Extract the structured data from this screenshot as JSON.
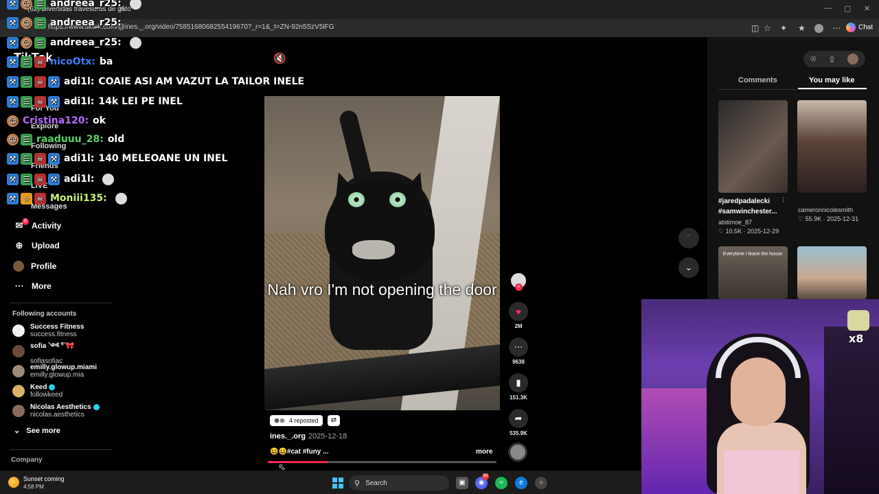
{
  "browser": {
    "tab_title": "(62) Divertidas travesuras de gatos",
    "tab_close": "✕",
    "url": "https://www.tiktok.com/@ines._.org/video/7585168068255419670?_r=1&_t=ZN-92n5SzV5lFG",
    "chat_label": "Chat",
    "win_minimize": "—",
    "win_maximize": "▢",
    "win_close": "✕"
  },
  "tiktok": {
    "logo": "TikTok",
    "mute_icon": "🔇",
    "nav_hidden": [
      "For You",
      "Explore",
      "Following",
      "Friends",
      "LIVE",
      "Messages"
    ],
    "nav": [
      {
        "label": "Activity",
        "icon": "✉",
        "badge": "6"
      },
      {
        "label": "Upload",
        "icon": "⊕"
      },
      {
        "label": "Profile",
        "icon": ""
      },
      {
        "label": "More",
        "icon": "⋯"
      }
    ],
    "following_title": "Following accounts",
    "following": [
      {
        "name": "Success Fitness",
        "handle": "success.fitness",
        "verified": false,
        "color": "#f2f2f2"
      },
      {
        "name": "sofia ༺ ͡° 🎀",
        "handle": "sofiasofiac",
        "verified": false,
        "color": "#6b4b3b"
      },
      {
        "name": "emilly.glowup.miami",
        "handle": "emilly.glowup.mia",
        "verified": false,
        "color": "#9a8a7a"
      },
      {
        "name": "Keed",
        "handle": "followkeed",
        "verified": true,
        "color": "#d9b36b"
      },
      {
        "name": "Nicolas Aesthetics",
        "handle": "nicolas.aesthetics",
        "verified": true,
        "color": "#8a6a5a"
      }
    ],
    "see_more": "See more",
    "company": "Company",
    "video": {
      "caption": "Nah vro I'm not opening the door",
      "reposted": "4 reposted",
      "author": "ines._.org",
      "date": "2025-12-18",
      "description": "😆😆#cat #funy ...",
      "more": "more",
      "progress": 0.26
    },
    "actions": {
      "likes": "2M",
      "comments": "9638",
      "saves": "151.3K",
      "shares": "535.9K"
    },
    "right_panel": {
      "tab_comments": "Comments",
      "tab_you_may_like": "You may like",
      "items": [
        {
          "caption1": "#jaredpadalecki",
          "caption2": "#samwinchester...",
          "user": "abitimoe_87",
          "stats": "♡ 10.5K · 2025-12-29"
        },
        {
          "user": "cameronnicolesmith",
          "stats": "♡ 55.9K · 2025-12-31"
        },
        {
          "overlay": "Everytime I leave the house"
        },
        {}
      ]
    }
  },
  "chat": [
    {
      "user": "andreea_r25:",
      "msg": "",
      "user_color": "#ffffff",
      "badges": [
        "blue",
        "skin",
        "green"
      ],
      "emote": true
    },
    {
      "user": "andreea_r25:",
      "msg": "",
      "user_color": "#ffffff",
      "badges": [
        "blue",
        "skin",
        "green"
      ],
      "emote": false
    },
    {
      "user": "andreea_r25:",
      "msg": "",
      "user_color": "#ffffff",
      "badges": [
        "blue",
        "skin",
        "green"
      ],
      "emote": true
    },
    {
      "user": "nicoOtx:",
      "msg": "ba",
      "user_color": "#3d7bf5",
      "badges": [
        "blue",
        "green",
        "red"
      ],
      "emote": false
    },
    {
      "user": "adi1l:",
      "msg": "COAIE ASI AM VAZUT LA TAILOR INELE",
      "user_color": "#ffffff",
      "badges": [
        "blue",
        "green",
        "red",
        "blue"
      ],
      "emote": false
    },
    {
      "user": "adi1l:",
      "msg": "14k LEI PE INEL",
      "user_color": "#ffffff",
      "badges": [
        "blue",
        "green",
        "red",
        "blue"
      ],
      "emote": false
    },
    {
      "user": "Cristina120:",
      "msg": "ok",
      "user_color": "#b66bff",
      "badges": [
        "skin"
      ],
      "emote": false
    },
    {
      "user": "raaduuu_28:",
      "msg": "old",
      "user_color": "#5bd16a",
      "badges": [
        "skin",
        "green"
      ],
      "emote": false
    },
    {
      "user": "adi1l:",
      "msg": "140 MELEOANE UN INEL",
      "user_color": "#ffffff",
      "badges": [
        "blue",
        "green",
        "red",
        "blue"
      ],
      "emote": false
    },
    {
      "user": "adi1l:",
      "msg": "",
      "user_color": "#ffffff",
      "badges": [
        "blue",
        "green",
        "red",
        "blue"
      ],
      "emote": true
    },
    {
      "user": "Moniii135:",
      "msg": "",
      "user_color": "#c8f07a",
      "badges": [
        "blue",
        "orange",
        "red"
      ],
      "emote": true
    }
  ],
  "webcam": {
    "emote_count": "x8"
  },
  "taskbar": {
    "weather_title": "Sunset coming",
    "time": "4:58 PM",
    "search_label": "Search",
    "discord_badge": "99"
  },
  "colors": {
    "tiktok_red": "#fe2c55",
    "verified": "#20d5ec",
    "windows_accent": "#4cc2ff"
  }
}
